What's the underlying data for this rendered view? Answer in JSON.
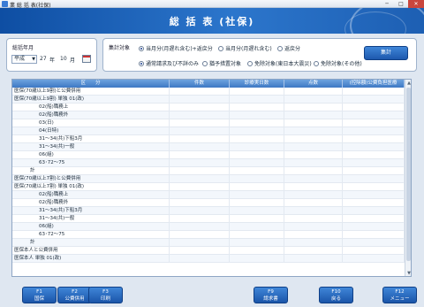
{
  "window": {
    "title": "業 総 括 表(社保)",
    "minimize": "─",
    "maximize": "□",
    "close": "✕"
  },
  "banner": {
    "heading": "総 括 表 (社保)"
  },
  "month_panel": {
    "label": "総括年月",
    "era": "平成",
    "year": "27",
    "year_unit": "年",
    "month": "10",
    "month_unit": "月"
  },
  "target_panel": {
    "label": "集計対象",
    "row1": [
      {
        "label": "当月分(月遅れ含む)+返戻分",
        "selected": true
      },
      {
        "label": "当月分(月遅れ含む)",
        "selected": false
      },
      {
        "label": "返戻分",
        "selected": false
      }
    ],
    "row2": [
      {
        "label": "通常請求及び不詳のみ",
        "selected": true
      },
      {
        "label": "猶予措置対象",
        "selected": false
      },
      {
        "label": "免除対象(東日本大震災)",
        "selected": false
      },
      {
        "label": "免除対象(その他)",
        "selected": false
      }
    ]
  },
  "aggregate_button": "集計",
  "grid": {
    "columns": [
      "区　　分",
      "件数",
      "診療実日数",
      "点数",
      "(控除額)公費負担医療"
    ],
    "rows": [
      {
        "name": "医保(70歳以上9割)と公費併用",
        "indent": 0
      },
      {
        "name": "医保(70歳以上9割) 単独 01(政)",
        "indent": 0
      },
      {
        "name": "02(船)職務上",
        "indent": 2
      },
      {
        "name": "02(船)職務外",
        "indent": 2
      },
      {
        "name": "03(日)",
        "indent": 2
      },
      {
        "name": "04(日特)",
        "indent": 2
      },
      {
        "name": "31～34(共)下船3月",
        "indent": 2
      },
      {
        "name": "31～34(共)一般",
        "indent": 2
      },
      {
        "name": "06(組)",
        "indent": 2
      },
      {
        "name": "63･72～75",
        "indent": 2
      },
      {
        "name": "計",
        "indent": 1
      },
      {
        "name": "医保(70歳以上7割)と公費併用",
        "indent": 0
      },
      {
        "name": "医保(70歳以上7割) 単独 01(政)",
        "indent": 0
      },
      {
        "name": "02(船)職務上",
        "indent": 2
      },
      {
        "name": "02(船)職務外",
        "indent": 2
      },
      {
        "name": "31～34(共)下船3月",
        "indent": 2
      },
      {
        "name": "31～34(共)一般",
        "indent": 2
      },
      {
        "name": "06(組)",
        "indent": 2
      },
      {
        "name": "63･72～75",
        "indent": 2
      },
      {
        "name": "計",
        "indent": 1
      },
      {
        "name": "医保本人と公費併用",
        "indent": 0
      },
      {
        "name": "医保本人 単独 01(政)",
        "indent": 0
      }
    ]
  },
  "fkeys": [
    {
      "id": "f1",
      "key": "F1",
      "label": "国保"
    },
    {
      "id": "f2",
      "key": "F2",
      "label": "公費併用"
    },
    {
      "id": "f3",
      "key": "F3",
      "label": "印刷"
    },
    {
      "id": "f9",
      "key": "F9",
      "label": "請求書"
    },
    {
      "id": "f10",
      "key": "F10",
      "label": "戻る"
    },
    {
      "id": "f12",
      "key": "F12",
      "label": "メニュー"
    }
  ]
}
